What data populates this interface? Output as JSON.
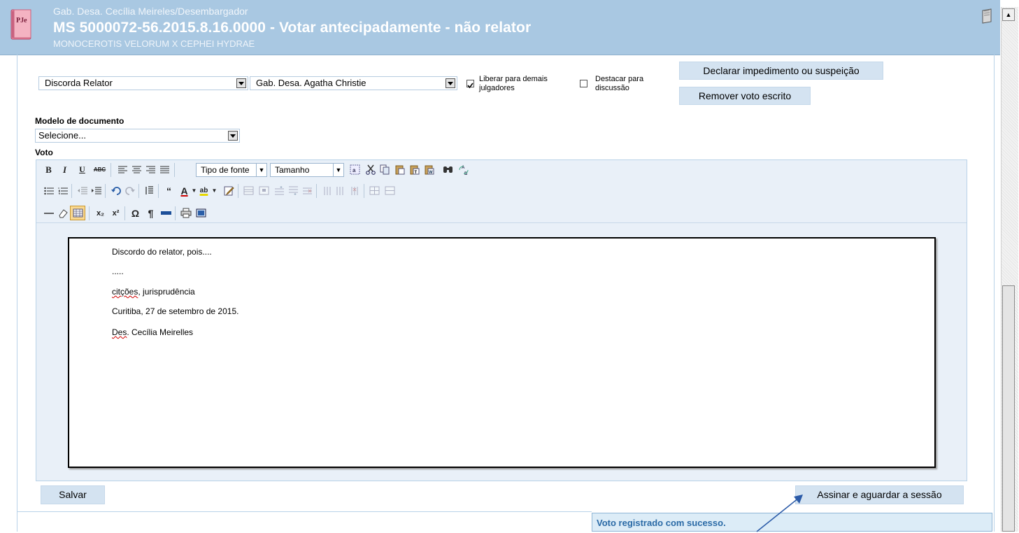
{
  "header": {
    "subtitle": "Gab. Desa. Cecília Meireles/Desembargador",
    "title": "MS 5000072-56.2015.8.16.0000 - Votar antecipadamente - não relator",
    "parties": "MONOCEROTIS VELORUM X CEPHEI HYDRAE",
    "logo_text": "PJe"
  },
  "vote_form": {
    "position_select": "Discorda Relator",
    "gabinete_select": "Gab. Desa. Agatha Christie",
    "liberar_label": "Liberar para demais julgadores",
    "liberar_checked": true,
    "destacar_label": "Destacar para discussão",
    "destacar_checked": false,
    "impedimento_button": "Declarar impedimento ou suspeição",
    "remover_button": "Remover voto escrito"
  },
  "model": {
    "label": "Modelo de documento",
    "select_value": "Selecione..."
  },
  "editor": {
    "label": "Voto",
    "font_combo": "Tipo de fonte",
    "size_combo": "Tamanho",
    "bold": "B",
    "italic": "I",
    "underline": "U",
    "strike": "ABC",
    "quote": "“",
    "font_color": "A",
    "highlight": "ab",
    "subscript": "x₂",
    "superscript": "x²",
    "omega": "Ω",
    "pilcrow": "¶",
    "lines": {
      "l1": "Discordo do relator, pois....",
      "l2": ".....",
      "l3_word": "citções",
      "l3_rest": ", jurisprudência",
      "l4": "Curitiba, 27 de setembro de 2015.",
      "l5_word": "Des",
      "l5_rest": ". Cecília Meirelles"
    }
  },
  "actions": {
    "save": "Salvar",
    "sign": "Assinar e aguardar a sessão"
  },
  "toast": {
    "message": "Voto registrado com sucesso."
  },
  "colors": {
    "header_bg": "#a9c8e2",
    "button_bg": "#d4e3f1",
    "toast_text": "#2a6aa6"
  }
}
